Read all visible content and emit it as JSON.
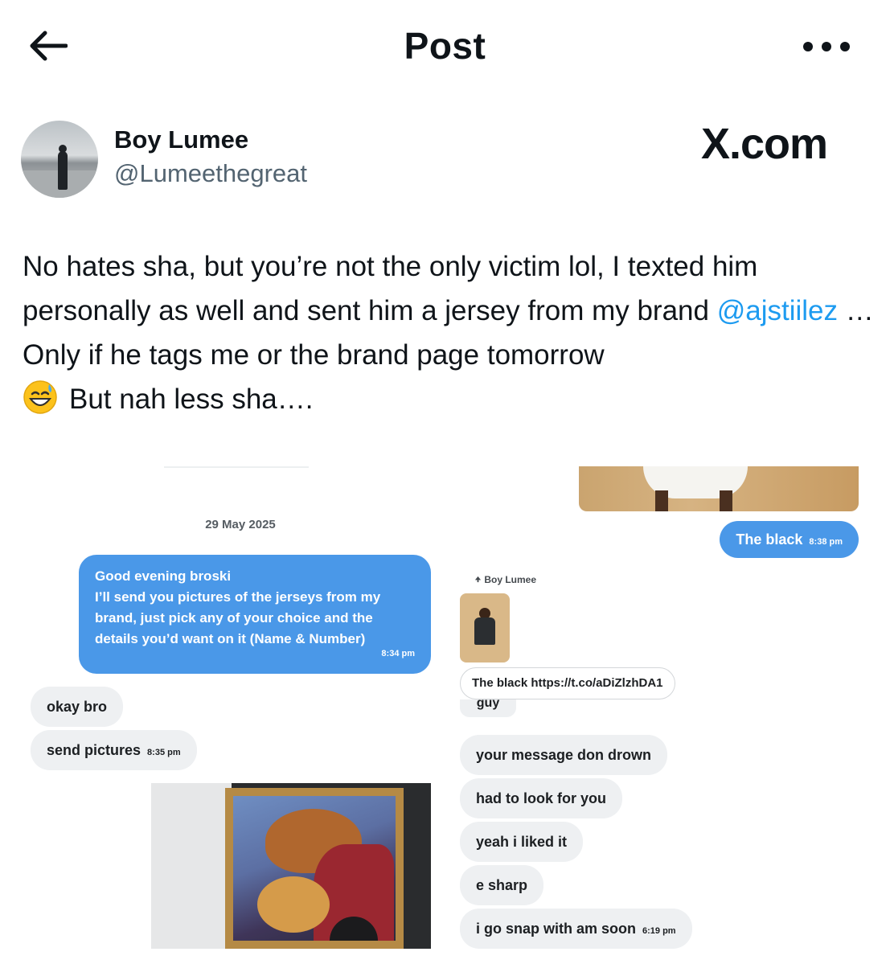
{
  "header": {
    "title": "Post"
  },
  "author": {
    "name": "Boy Lumee",
    "handle": "@Lumeethegreat"
  },
  "watermark": "X.com",
  "tweet": {
    "part1": "No hates sha, but you’re not the only victim lol, I  texted him personally as well and sent him a jersey from my brand ",
    "mention": "@ajstiilez",
    "part2": " … Only if he tags me or the brand page tomorrow",
    "part3": "But nah less sha…."
  },
  "left_chat": {
    "date": "29 May 2025",
    "outgoing": {
      "lines": [
        "Good evening broski",
        "I’ll send you pictures of the jerseys from my",
        "brand, just pick any of your choice and the",
        "details you’d want on it (Name & Number)"
      ],
      "time": "8:34 pm"
    },
    "incoming": [
      {
        "text": "okay bro",
        "time": ""
      },
      {
        "text": "send pictures",
        "time": "8:35 pm"
      }
    ]
  },
  "right_chat": {
    "outgoing": {
      "text": "The black",
      "time": "8:38 pm"
    },
    "reply_label": "Boy Lumee",
    "link_text": "The black https://t.co/aDiZlzhDA1",
    "cut_text": "guy",
    "incoming": [
      {
        "text": "your message don drown",
        "time": ""
      },
      {
        "text": "had to look for you",
        "time": ""
      },
      {
        "text": "yeah i liked it",
        "time": ""
      },
      {
        "text": "e sharp",
        "time": ""
      },
      {
        "text": "i go snap with am soon",
        "time": "6:19 pm"
      }
    ]
  },
  "colors": {
    "text": "#0f1419",
    "secondary": "#536471",
    "link": "#1d9bf0",
    "chat_blue": "#4a98e8",
    "chat_grey": "#eef0f2"
  },
  "icons": [
    "back-arrow-icon",
    "more-dots-icon",
    "sweat-smile-emoji-icon",
    "reply-arrow-icon"
  ]
}
